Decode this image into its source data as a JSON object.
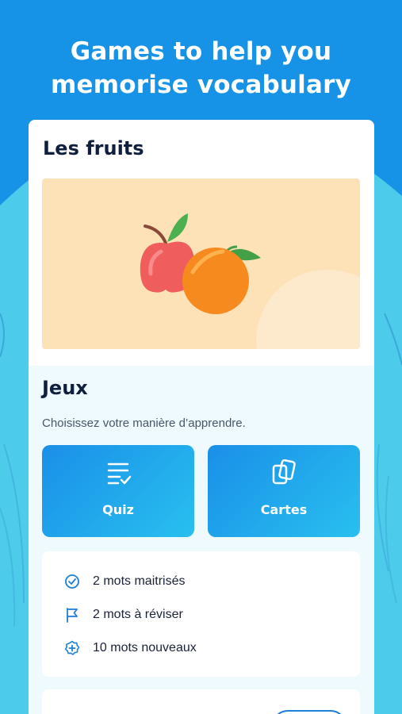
{
  "headline": "Games to help you memorise vocabulary",
  "card": {
    "title": "Les fruits",
    "hero_image": "apple-and-orange-illustration"
  },
  "games": {
    "title": "Jeux",
    "subtitle": "Choisissez votre manière d’apprendre.",
    "buttons": [
      {
        "label": "Quiz",
        "icon": "checklist-icon"
      },
      {
        "label": "Cartes",
        "icon": "cards-icon"
      }
    ]
  },
  "stats": [
    {
      "text": "2 mots maitrisés",
      "icon": "check-circle-icon"
    },
    {
      "text": "2 mots à réviser",
      "icon": "flag-icon"
    },
    {
      "text": "10 mots nouveaux",
      "icon": "plus-badge-icon"
    }
  ],
  "colors": {
    "background": "#1692e6",
    "accent": "#28c0ef",
    "title_text": "#0f1f3d"
  }
}
